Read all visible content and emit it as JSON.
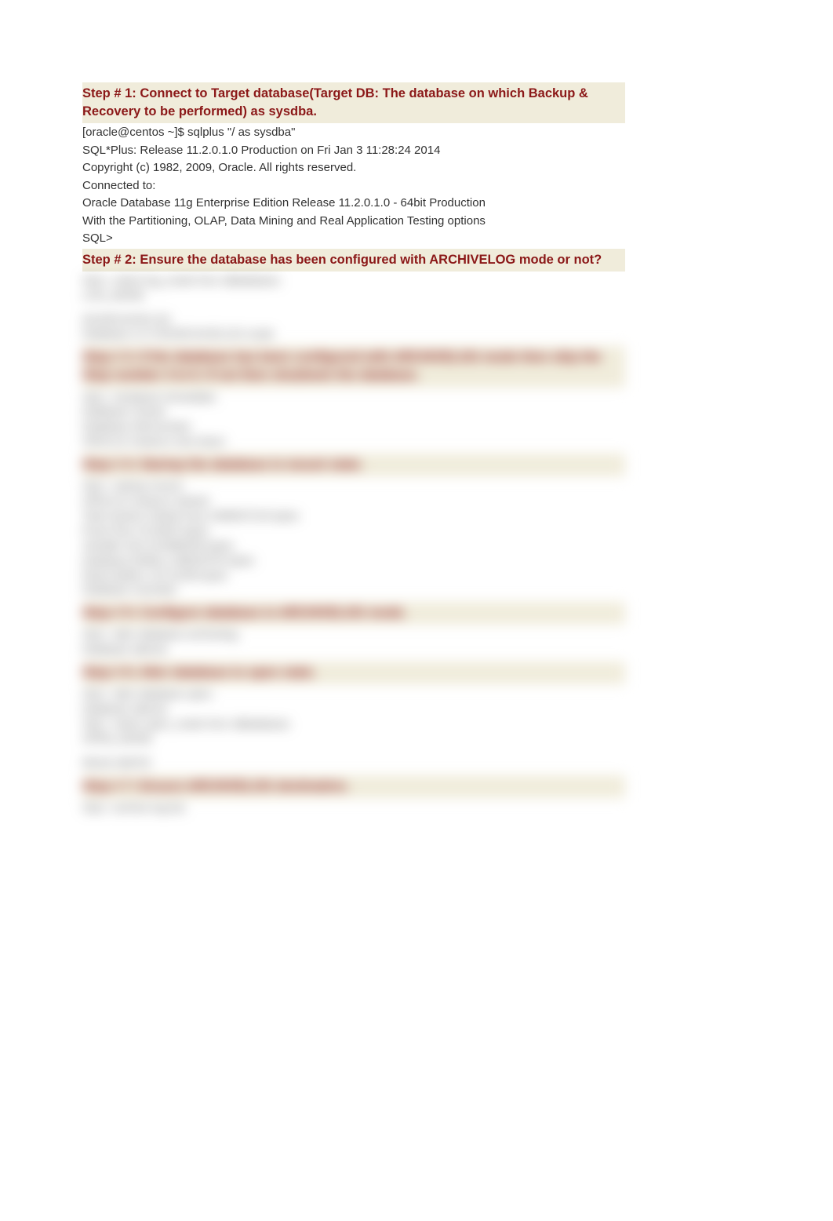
{
  "step1": {
    "heading": "Step # 1: Connect to Target database(Target DB: The database on which Backup & Recovery to be performed) as sysdba.",
    "lines": [
      "[oracle@centos ~]$ sqlplus \"/ as sysdba\"",
      "SQL*Plus: Release 11.2.0.1.0 Production on Fri Jan 3 11:28:24 2014",
      "Copyright (c) 1982, 2009, Oracle. All rights reserved.",
      "Connected to:",
      "Oracle Database 11g Enterprise Edition Release 11.2.0.1.0 - 64bit Production",
      "With the Partitioning, OLAP, Data Mining and Real Application Testing options",
      "SQL>"
    ]
  },
  "step2": {
    "heading": "Step # 2: Ensure the database has been configured with ARCHIVELOG mode or not?"
  },
  "blurred": {
    "block1": [
      "SQL> select log_mode from v$database;",
      "LOG_MODE"
    ],
    "block2": [
      "NOARCHIVELOG",
      "Database is in NOARCHIVELOG mode"
    ],
    "step3": {
      "heading": "Step # 3: If the database has been configured with ARCHIVELOG mode then skip the Step number 4 to 6. If not then shutdown the database.",
      "lines": [
        "SQL> shutdown immediate;",
        "Database closed.",
        "Database dismounted.",
        "ORACLE instance shut down."
      ]
    },
    "step4": {
      "heading": "Step # 4: Startup the database in mount state.",
      "lines": [
        "SQL> startup mount;",
        "ORACLE instance started.",
        "Total System Global Area 1068937216 bytes",
        "Fixed Size 2213632 bytes",
        "Variable Size 813696256 bytes",
        "Database Buffers 238026752 bytes",
        "Redo Buffers 15712256 bytes",
        "Database mounted."
      ]
    },
    "step5": {
      "heading": "Step # 5: Configure database in ARCHIVELOG mode.",
      "lines": [
        "SQL> alter database archivelog;",
        "Database altered."
      ]
    },
    "step6": {
      "heading": "Step # 6: Alter database to open state.",
      "lines": [
        "SQL> alter database open;",
        "Database altered.",
        "SQL> select open_mode from v$database;",
        "OPEN_MODE"
      ]
    },
    "block3": [
      "READ WRITE"
    ],
    "step7": {
      "heading": "Step # 7: Ensure ARCHIVELOG destination.",
      "lines": [
        "SQL> archive log list;"
      ]
    }
  }
}
